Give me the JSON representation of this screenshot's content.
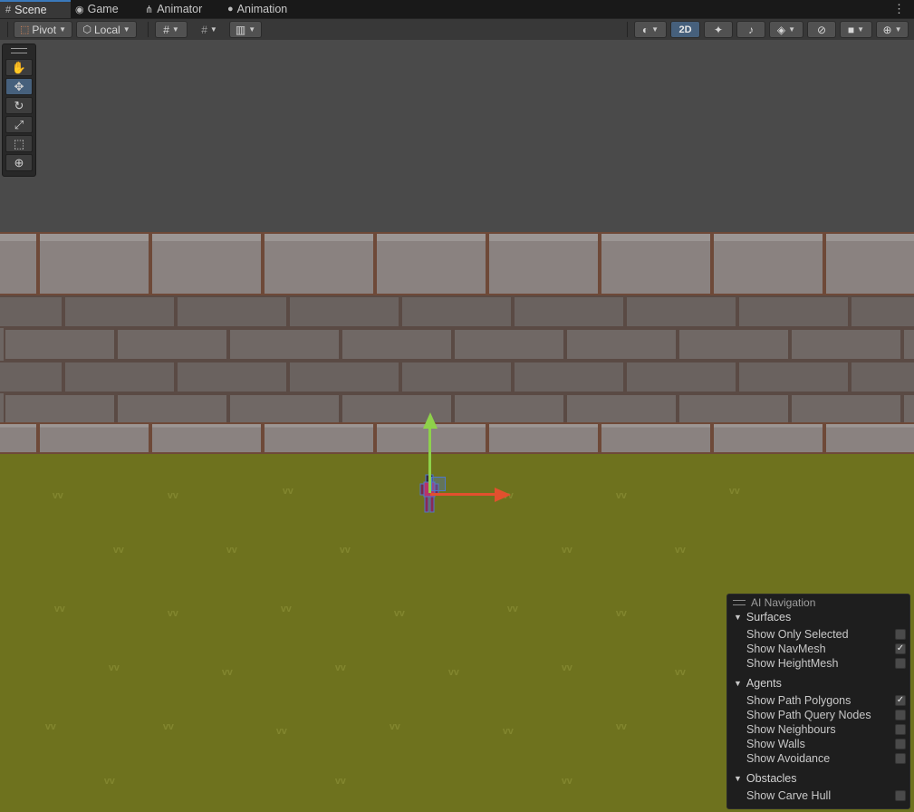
{
  "tabs": [
    {
      "label": "Scene",
      "icon": "grid-icon",
      "active": true
    },
    {
      "label": "Game",
      "icon": "gamepad-icon",
      "active": false
    },
    {
      "label": "Animator",
      "icon": "animator-icon",
      "active": false
    },
    {
      "label": "Animation",
      "icon": "clock-icon",
      "active": false
    }
  ],
  "toolbar": {
    "pivot_label": "Pivot",
    "local_label": "Local",
    "mode_2d_label": "2D"
  },
  "tools": [
    "hand-tool",
    "move-tool",
    "rotate-tool",
    "scale-tool",
    "rect-tool",
    "transform-tool"
  ],
  "ai_navigation": {
    "title": "AI Navigation",
    "sections": [
      {
        "label": "Surfaces",
        "options": [
          {
            "label": "Show Only Selected",
            "checked": false
          },
          {
            "label": "Show NavMesh",
            "checked": true
          },
          {
            "label": "Show HeightMesh",
            "checked": false
          }
        ]
      },
      {
        "label": "Agents",
        "options": [
          {
            "label": "Show Path Polygons",
            "checked": true
          },
          {
            "label": "Show Path Query Nodes",
            "checked": false
          },
          {
            "label": "Show Neighbours",
            "checked": false
          },
          {
            "label": "Show Walls",
            "checked": false
          },
          {
            "label": "Show Avoidance",
            "checked": false
          }
        ]
      },
      {
        "label": "Obstacles",
        "options": [
          {
            "label": "Show Carve Hull",
            "checked": false
          }
        ]
      }
    ]
  },
  "colors": {
    "accent": "#3a79bb",
    "grass": "#6e721e",
    "wall": "#6d6562",
    "gizmo_x": "#e2502e",
    "gizmo_y": "#8ed14a"
  }
}
